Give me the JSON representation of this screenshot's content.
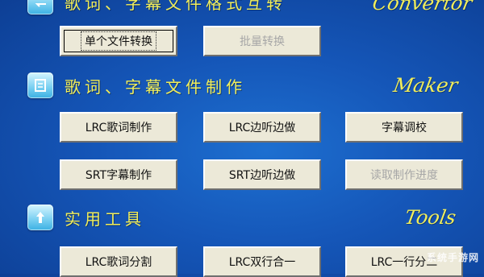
{
  "sections": [
    {
      "title": "歌词、字幕文件格式互转",
      "english": "Convertor",
      "icon": "converter-icon"
    },
    {
      "title": "歌词、字幕文件制作",
      "english": "Maker",
      "icon": "maker-icon"
    },
    {
      "title": "实用工具",
      "english": "Tools",
      "icon": "tools-icon"
    }
  ],
  "converter_buttons": {
    "single_convert": "单个文件转换",
    "batch_convert": "批量转换"
  },
  "maker_buttons": {
    "lrc_make": "LRC歌词制作",
    "lrc_listen_edit": "LRC边听边做",
    "subtitle_adjust": "字幕调校",
    "srt_make": "SRT字幕制作",
    "srt_listen_edit": "SRT边听边做",
    "read_progress": "读取制作进度"
  },
  "tools_buttons": {
    "lrc_split": "LRC歌词分割",
    "lrc_dual_merge": "LRC双行合一",
    "lrc_one_to_two": "LRC一行分二"
  },
  "watermark": "系统手游网",
  "colors": {
    "background": "#1556b8",
    "title_yellow": "#f2ee5a",
    "button_face": "#ece9d8"
  }
}
